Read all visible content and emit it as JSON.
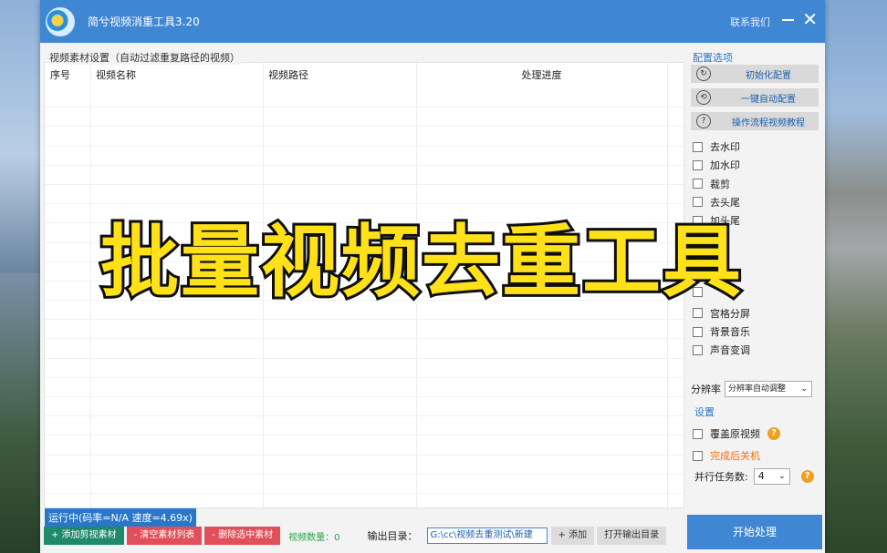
{
  "window": {
    "title": "简兮视频消重工具3.20",
    "contact": "联系我们"
  },
  "left": {
    "group_label": "视频素材设置（自动过滤重复路径的视频）",
    "columns": [
      "序号",
      "视频名称",
      "视频路径",
      "处理进度"
    ],
    "status": "运行中(码率=N/A 速度=4.69x)",
    "buttons": {
      "add": "+ 添加剪视素材",
      "clear": "- 清空素材列表",
      "delete": "- 删除选中素材"
    },
    "count_label": "视频数量：0",
    "output_label": "输出目录：",
    "output_path": "G:\\cc\\视频去重测试\\新建",
    "add_btn": "+ 添加",
    "open_output_btn": "打开输出目录"
  },
  "right": {
    "config_label": "配置选项",
    "cfg_buttons": [
      "初始化配置",
      "一键自动配置",
      "操作流程视频教程"
    ],
    "options": [
      "去水印",
      "加水印",
      "裁剪",
      "去头尾",
      "加头尾",
      "",
      "",
      "",
      "",
      "宫格分屏",
      "背景音乐",
      "声音变调"
    ],
    "resolution_label": "分辨率",
    "resolution_value": "分辨率自动调整",
    "settings_label": "设置",
    "overwrite": "覆盖原视频",
    "shutdown": "完成后关机",
    "parallel_label": "并行任务数:",
    "parallel_value": "4",
    "start": "开始处理"
  },
  "overlay_text": "批量视频去重工具"
}
